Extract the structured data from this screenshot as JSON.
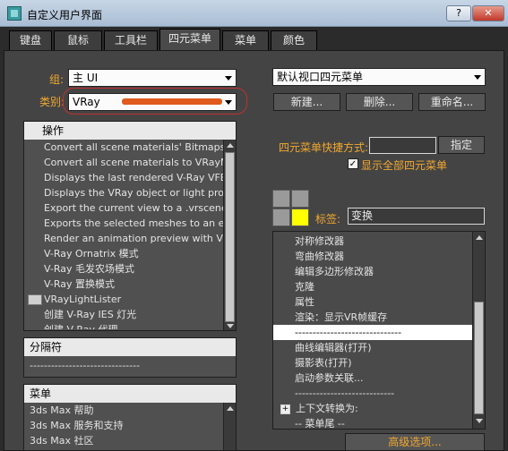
{
  "window": {
    "title": "自定义用户界面",
    "help_label": "?",
    "close_label": "✕"
  },
  "tabs": [
    {
      "label": "键盘"
    },
    {
      "label": "鼠标"
    },
    {
      "label": "工具栏"
    },
    {
      "label": "四元菜单"
    },
    {
      "label": "菜单"
    },
    {
      "label": "颜色"
    }
  ],
  "active_tab": "四元菜单",
  "group": {
    "label": "组:",
    "value": "主 UI"
  },
  "category": {
    "label": "类别:",
    "value": "VRay"
  },
  "actions": {
    "header": "操作",
    "items": [
      "Convert all scene materials' Bitmaps t...",
      "Convert all scene materials to VRayM...",
      "Displays the last rendered V-Ray VFB...",
      "Displays the VRay object or light prop...",
      "Export the current view to a .vrscene...",
      "Exports the selected meshes to an ex...",
      "Render an animation preview with V-...",
      "V-Ray Ornatrix 模式",
      "V-Ray 毛发农场模式",
      "V-Ray 置换模式",
      "VRayLightLister",
      "创建 V-Ray IES 灯光",
      "创建 V-Ray 代理"
    ]
  },
  "separator_list": {
    "header": "分隔符",
    "items": [
      "-------------------------------"
    ]
  },
  "menus_list": {
    "header": "菜单",
    "items": [
      "3ds Max 帮助",
      "3ds Max 服务和支持",
      "3ds Max 社区"
    ]
  },
  "quad_menu_select": {
    "value": "默认视口四元菜单"
  },
  "buttons": {
    "new": "新建...",
    "delete": "删除...",
    "rename": "重命名..."
  },
  "shortcut": {
    "label": "四元菜单快捷方式:",
    "value": "",
    "assign": "指定"
  },
  "show_all": {
    "label": "显示全部四元菜单",
    "checked": true
  },
  "tag": {
    "label": "标签:",
    "value": "变换"
  },
  "quad_items": [
    "对称修改器",
    "弯曲修改器",
    "编辑多边形修改器",
    "克隆",
    "属性",
    "渲染：显示VR帧缓存",
    "------------------------------",
    "曲线编辑器(打开)",
    "摄影表(打开)",
    "启动参数关联...",
    "----------------------------",
    "上下文转换为:",
    "-- 菜单尾 --"
  ],
  "advanced": {
    "label": "高级选项..."
  },
  "colors": {
    "accent": "#f0a830",
    "panel": "#444444",
    "highlight_yellow": "#ffff00",
    "annotation_red": "#e05a1e"
  }
}
